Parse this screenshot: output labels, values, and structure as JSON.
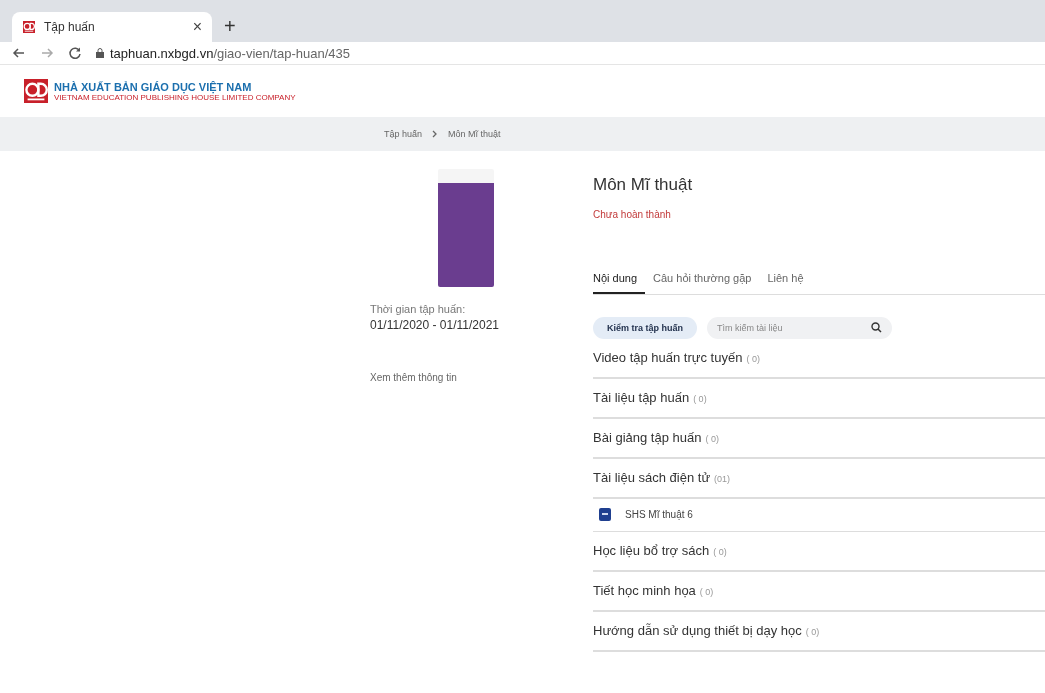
{
  "browser": {
    "tab_title": "Tập huấn",
    "tab_close": "×",
    "new_tab": "+",
    "url_domain": "taphuan.nxbgd.vn",
    "url_path": "/giao-vien/tap-huan/435"
  },
  "header": {
    "publisher_name": "NHÀ XUẤT BẢN GIÁO DỤC VIỆT NAM",
    "publisher_subtitle": "VIETNAM EDUCATION PUBLISHING HOUSE LIMITED COMPANY"
  },
  "breadcrumb": [
    {
      "label": "Tập huấn"
    },
    {
      "label": "Môn Mĩ thuật"
    }
  ],
  "sidebar": {
    "period_label": "Thời gian tập huấn:",
    "period_value": "01/11/2020 - 01/11/2021",
    "more_link": "Xem thêm thông tin"
  },
  "course": {
    "title": "Môn Mĩ thuật",
    "status": "Chưa hoàn thành"
  },
  "tabs": [
    {
      "label": "Nội dung",
      "selected": true
    },
    {
      "label": "Câu hỏi thường gặp",
      "selected": false
    },
    {
      "label": "Liên hệ",
      "selected": false
    }
  ],
  "check_button": "Kiểm tra tập huấn",
  "search": {
    "placeholder": "Tìm kiếm tài liệu"
  },
  "sections": [
    {
      "title": "Video tập huấn trực tuyến",
      "count": "( 0)"
    },
    {
      "title": "Tài liệu tập huấn",
      "count": "( 0)"
    },
    {
      "title": "Bài giảng tập huấn",
      "count": "( 0)"
    },
    {
      "title": "Tài liệu sách điện tử",
      "count": "(01)",
      "items": [
        {
          "name": "SHS Mĩ thuật 6"
        }
      ]
    },
    {
      "title": "Học liệu bổ trợ sách",
      "count": "( 0)"
    },
    {
      "title": "Tiết học minh họa",
      "count": "( 0)"
    },
    {
      "title": "Hướng dẫn sử dụng thiết bị dạy học",
      "count": "( 0)"
    }
  ]
}
